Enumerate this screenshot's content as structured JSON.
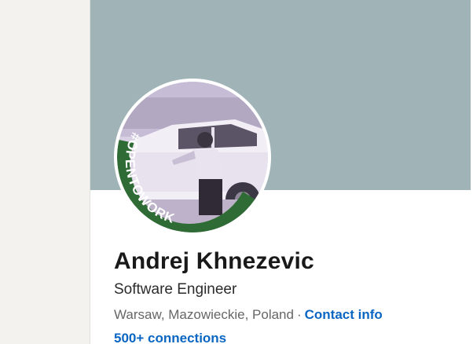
{
  "profile": {
    "name": "Andrej Khnezevic",
    "headline": "Software Engineer",
    "location": "Warsaw, Mazowieckie, Poland",
    "separator": "·",
    "contact_info_label": "Contact info",
    "connections_label": "500+ connections",
    "open_to_work_frame": "#OPENTOWORK"
  },
  "colors": {
    "cover": "#a0b4b8",
    "frame_green": "#2f6b34",
    "link": "#0a66c2"
  }
}
